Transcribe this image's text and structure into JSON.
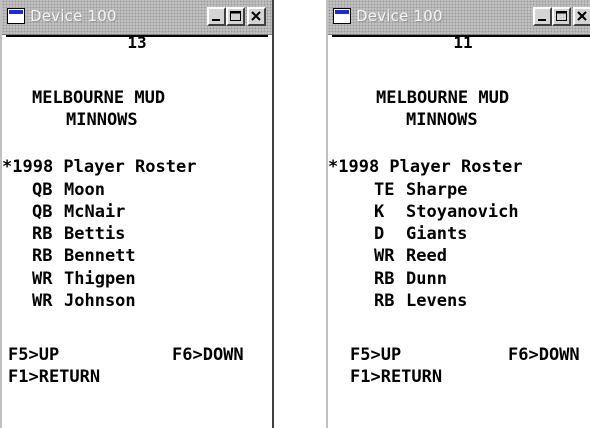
{
  "windows": [
    {
      "title": "Device 100",
      "page_number": "13",
      "team_line1": "MELBOURNE MUD",
      "team_line2": "MINNOWS",
      "roster_header": "*1998 Player Roster",
      "players": [
        {
          "pos": "QB",
          "name": "Moon"
        },
        {
          "pos": "QB",
          "name": "McNair"
        },
        {
          "pos": "RB",
          "name": "Bettis"
        },
        {
          "pos": "RB",
          "name": "Bennett"
        },
        {
          "pos": "WR",
          "name": "Thigpen"
        },
        {
          "pos": "WR",
          "name": "Johnson"
        }
      ],
      "key_up": "F5>UP",
      "key_down": "F6>DOWN",
      "key_return": "F1>RETURN"
    },
    {
      "title": "Device 100",
      "page_number": "11",
      "team_line1": "MELBOURNE MUD",
      "team_line2": "MINNOWS",
      "roster_header": "*1998 Player Roster",
      "players": [
        {
          "pos": "TE",
          "name": "Sharpe"
        },
        {
          "pos": "K",
          "name": "Stoyanovich"
        },
        {
          "pos": "D",
          "name": "Giants"
        },
        {
          "pos": "WR",
          "name": "Reed"
        },
        {
          "pos": "RB",
          "name": "Dunn"
        },
        {
          "pos": "RB",
          "name": "Levens"
        }
      ],
      "key_up": "F5>UP",
      "key_down": "F6>DOWN",
      "key_return": "F1>RETURN"
    }
  ]
}
